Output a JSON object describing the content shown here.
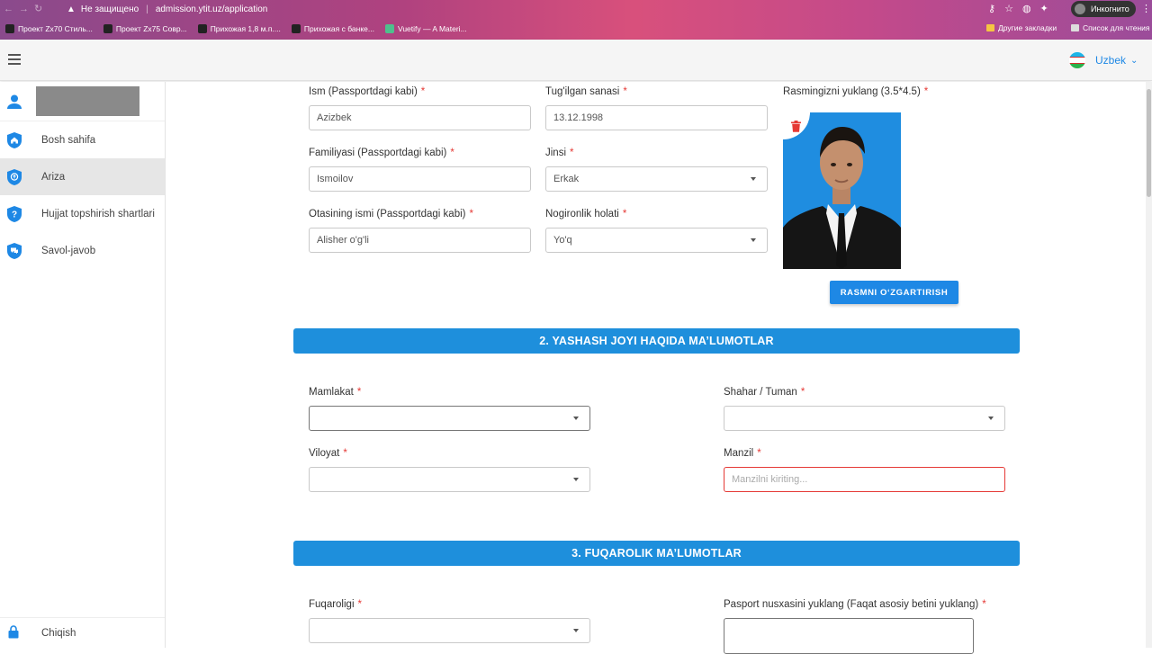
{
  "browser": {
    "security_label": "Не защищено",
    "url": "admission.ytit.uz/application",
    "incognito_label": "Инкогнито",
    "bookmarks": [
      {
        "label": "Проект Zx70 Стиль..."
      },
      {
        "label": "Проект Zx75 Совр..."
      },
      {
        "label": "Прихожая 1,8 м.п...."
      },
      {
        "label": "Прихожая с банке..."
      },
      {
        "label": "Vuetify — A Materi..."
      }
    ],
    "other_bookmarks": "Другие закладки",
    "reading_list": "Список для чтения"
  },
  "header": {
    "language": "Uzbek",
    "flag_colors": [
      "#1eb5e8",
      "#ffffff",
      "#2bb24c"
    ]
  },
  "sidebar": {
    "items": [
      {
        "label": "Bosh sahifa",
        "icon": "home-shield-icon"
      },
      {
        "label": "Ariza",
        "icon": "upload-shield-icon"
      },
      {
        "label": "Hujjat topshirish shartlari",
        "icon": "question-shield-icon"
      },
      {
        "label": "Savol-javob",
        "icon": "chat-shield-icon"
      }
    ],
    "logout_label": "Chiqish"
  },
  "form": {
    "first_name": {
      "label": "Ism (Passportdagi kabi)",
      "value": "Azizbek"
    },
    "birth_date": {
      "label": "Tug'ilgan sanasi",
      "value": "13.12.1998"
    },
    "photo_label": "Rasmingizni yuklang (3.5*4.5)",
    "last_name": {
      "label": "Familiyasi (Passportdagi kabi)",
      "value": "Ismoilov"
    },
    "gender": {
      "label": "Jinsi",
      "value": "Erkak"
    },
    "patronymic": {
      "label": "Otasining ismi (Passportdagi kabi)",
      "value": "Alisher o'g'li"
    },
    "disability": {
      "label": "Nogironlik holati",
      "value": "Yo'q"
    },
    "change_photo_button": "RASMNI O‘ZGARTIRISH",
    "required_mark": "*"
  },
  "section2": {
    "title": "2. YASHASH JOYI HAQIDA MA’LUMOTLAR",
    "country": {
      "label": "Mamlakat",
      "value": ""
    },
    "city": {
      "label": "Shahar / Tuman",
      "value": ""
    },
    "region": {
      "label": "Viloyat",
      "value": ""
    },
    "address": {
      "label": "Manzil",
      "placeholder": "Manzilni kiriting..."
    }
  },
  "section3": {
    "title": "3. FUQAROLIK MA’LUMOTLAR",
    "citizenship": {
      "label": "Fuqaroligi",
      "value": ""
    },
    "passport_upload": {
      "label": "Pasport nusxasini yuklang (Faqat asosiy betini yuklang)"
    }
  }
}
